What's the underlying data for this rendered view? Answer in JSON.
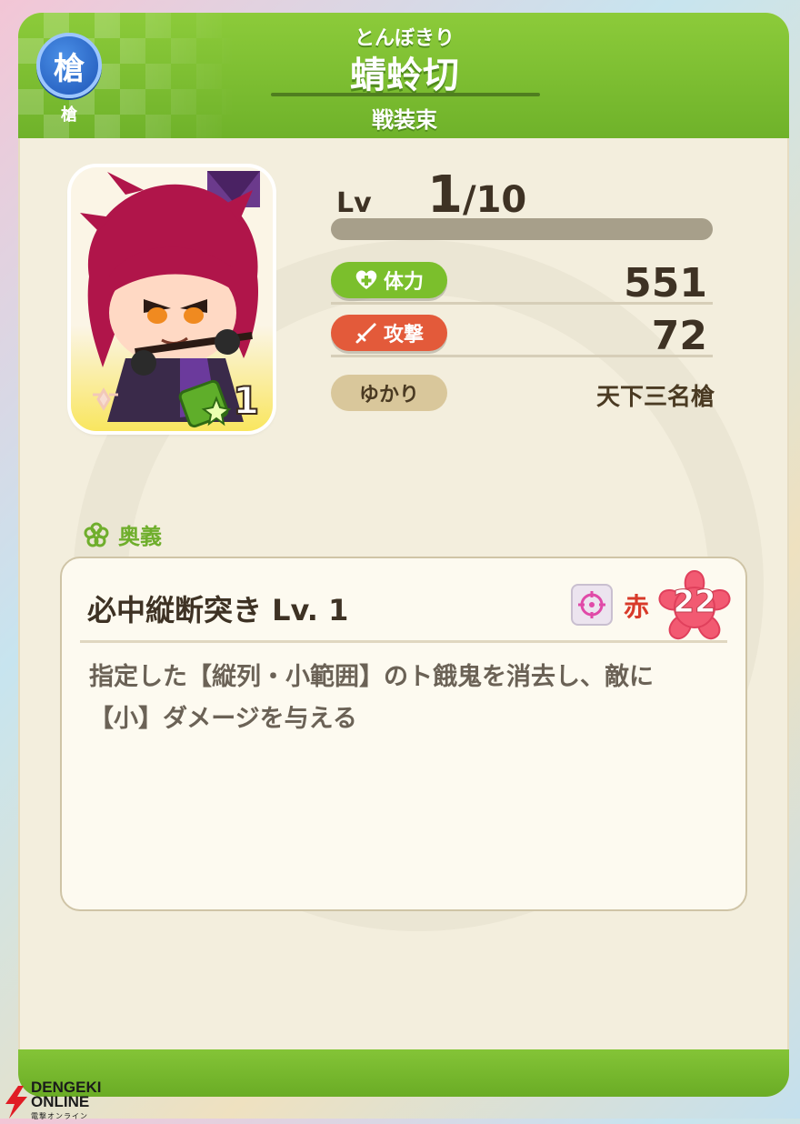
{
  "header": {
    "weapon_badge": "槍",
    "weapon_caption": "槍",
    "reading": "とんぼきり",
    "name": "蜻蛉切",
    "costume": "戦装束"
  },
  "portrait": {
    "rarity": "1"
  },
  "stats": {
    "lv_label": "Lv",
    "lv_current": "1",
    "lv_max": "/10",
    "exp_progress": 0.0,
    "hp_label": "体力",
    "hp_value": "551",
    "atk_label": "攻撃",
    "atk_value": "72",
    "yukari_label": "ゆかり",
    "yukari_value": "天下三名槍"
  },
  "skill": {
    "section_label": "奥義",
    "title": "必中縦断突き Lv. 1",
    "color_word": "赤",
    "cost": "22",
    "description_line1": "指定した【縦列・小範囲】のト餓鬼を消去し、敵に",
    "description_line2": "【小】ダメージを与える"
  },
  "watermark_logo": {
    "line1": "DENGEKI",
    "line2": "ONLINE",
    "line3": "電撃オンライン"
  },
  "colors": {
    "header_green": "#7bbf2c",
    "attack_red": "#e35a3a",
    "card_bg": "#f3eedd",
    "text_brown": "#3e3224"
  }
}
